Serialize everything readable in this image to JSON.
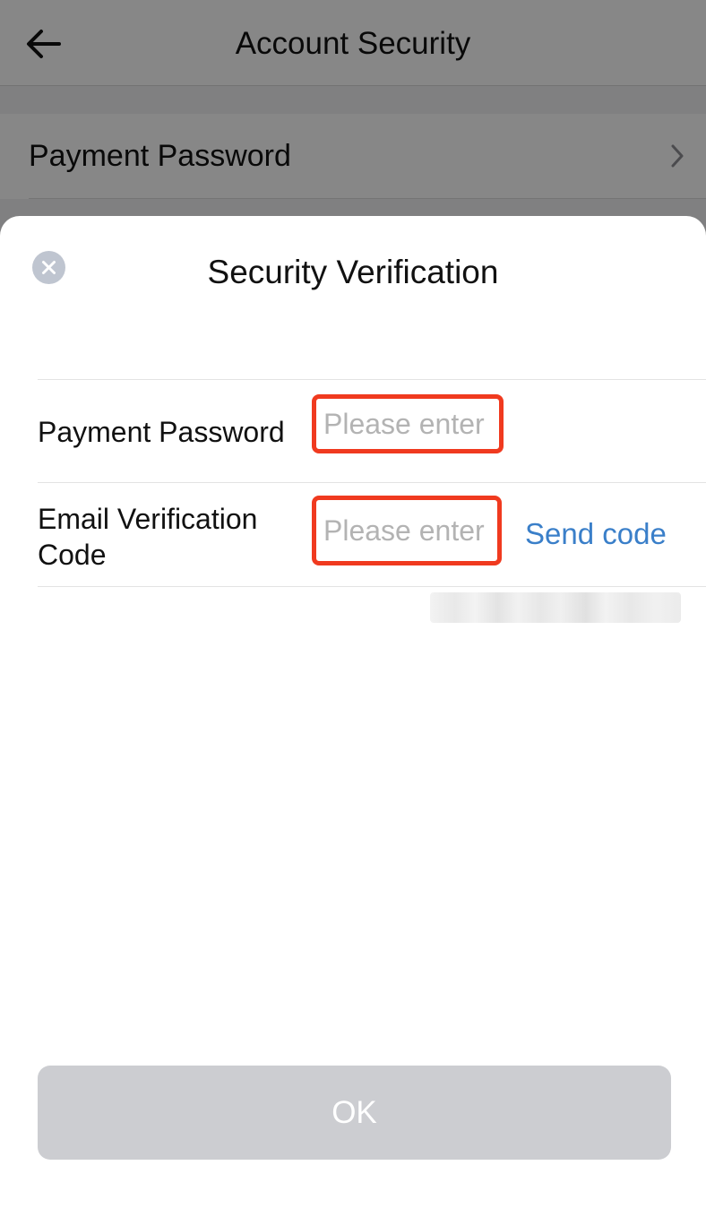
{
  "header": {
    "title": "Account Security",
    "back_icon": "back-arrow-icon"
  },
  "settings": {
    "items": [
      {
        "label": "Payment Password",
        "icon": "chevron-right-icon"
      }
    ]
  },
  "dialog": {
    "title": "Security Verification",
    "close_icon": "close-icon",
    "fields": [
      {
        "label": "Payment Password",
        "value": "",
        "placeholder": "Please enter"
      },
      {
        "label": "Email Verification Code",
        "value": "",
        "placeholder": "Please enter",
        "action_label": "Send code"
      }
    ],
    "ok_label": "OK"
  },
  "colors": {
    "highlight_border": "#f03a1f",
    "link": "#3a7fc9",
    "disabled_button": "#cccdd1",
    "close_icon_bg": "#bfc5d0"
  }
}
